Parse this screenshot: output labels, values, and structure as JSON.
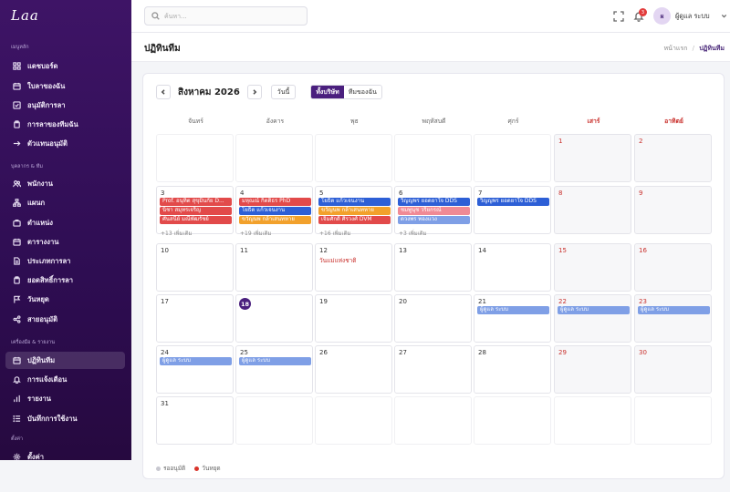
{
  "app": {
    "logo": "Laa"
  },
  "sidebar": {
    "sections": [
      {
        "title": "เมนูหลัก",
        "items": [
          {
            "label": "แดชบอร์ด",
            "icon": "grid-icon"
          },
          {
            "label": "ใบลาของฉัน",
            "icon": "calendar-icon"
          },
          {
            "label": "อนุมัติการลา",
            "icon": "check-square-icon"
          },
          {
            "label": "การลาของทีมฉัน",
            "icon": "clipboard-icon"
          },
          {
            "label": "ตัวแทนอนุมัติ",
            "icon": "arrow-right-icon"
          }
        ]
      },
      {
        "title": "บุคลากร & ทีม",
        "items": [
          {
            "label": "พนักงาน",
            "icon": "users-icon"
          },
          {
            "label": "แผนก",
            "icon": "org-icon"
          },
          {
            "label": "ตำแหน่ง",
            "icon": "briefcase-icon"
          },
          {
            "label": "ตารางงาน",
            "icon": "calendar-icon"
          },
          {
            "label": "ประเภทการลา",
            "icon": "document-icon"
          },
          {
            "label": "ยอดสิทธิ์การลา",
            "icon": "clipboard-icon"
          },
          {
            "label": "วันหยุด",
            "icon": "flag-icon"
          },
          {
            "label": "สายอนุมัติ",
            "icon": "share-icon"
          }
        ]
      },
      {
        "title": "เครื่องมือ & รายงาน",
        "items": [
          {
            "label": "ปฏิทินทีม",
            "icon": "calendar-icon",
            "active": true
          },
          {
            "label": "การแจ้งเตือน",
            "icon": "bell-icon"
          },
          {
            "label": "รายงาน",
            "icon": "bar-chart-icon"
          },
          {
            "label": "บันทึกการใช้งาน",
            "icon": "list-icon"
          }
        ]
      },
      {
        "title": "ตั้งค่า",
        "items": [
          {
            "label": "ตั้งค่า",
            "icon": "gear-icon"
          }
        ]
      }
    ]
  },
  "topbar": {
    "search_placeholder": "ค้นหา...",
    "notification_count": "3",
    "avatar_initial": "ผ",
    "user_name": "ผู้ดูแล ระบบ"
  },
  "page": {
    "title": "ปฏิทินทีม",
    "breadcrumb_home": "หน้าแรก",
    "breadcrumb_sep": "/",
    "breadcrumb_current": "ปฏิทินทีม"
  },
  "calendar": {
    "month_title": "สิงหาคม 2026",
    "today_label": "วันนี้",
    "scope_options": [
      "ทั้งบริษัท",
      "ทีมของฉัน"
    ],
    "scope_selected": "ทั้งบริษัท",
    "weekdays": [
      "จันทร์",
      "อังคาร",
      "พุธ",
      "พฤหัสบดี",
      "ศุกร์",
      "เสาร์",
      "อาทิตย์"
    ],
    "today_day": 18,
    "colors": {
      "red": "#e24a4a",
      "blue": "#2d5fd6",
      "orange": "#f2a12c",
      "pink": "#f08a95",
      "lightblue": "#7f9fe6"
    },
    "weeks": [
      [
        null,
        null,
        null,
        null,
        null,
        {
          "d": 1
        },
        {
          "d": 2
        }
      ],
      [
        {
          "d": 3,
          "events": [
            {
              "t": "Prof. อนุทิต สุขุมิ้นกัย D...",
              "c": "red"
            },
            {
              "t": "นิชา สมุทรเจริญ",
              "c": "red"
            },
            {
              "t": "ศันสนีย์ มณีพัฒรัชย์",
              "c": "red"
            }
          ],
          "more": "+13 เพิ่มเติม"
        },
        {
          "d": 4,
          "events": [
            {
              "t": "มหุณณ์ กิตติธร PhD",
              "c": "red"
            },
            {
              "t": "โยธิต แก้วเจนงาน",
              "c": "blue"
            },
            {
              "t": "ขวัญนพ กล้าเสนทหาย",
              "c": "orange"
            }
          ],
          "more": "+19 เพิ่มเติม"
        },
        {
          "d": 5,
          "events": [
            {
              "t": "โยธิต แก้วเจนงาน",
              "c": "blue"
            },
            {
              "t": "ขวัญนพ กล้าเสนทหาย",
              "c": "orange"
            },
            {
              "t": "เจิมศักดิ์ ศิรวงศ์ DVM",
              "c": "red"
            }
          ],
          "more": "+16 เพิ่มเติม"
        },
        {
          "d": 6,
          "events": [
            {
              "t": "วิญญพร ยอดยาใจ DDS",
              "c": "blue"
            },
            {
              "t": "ชมพูนุช วริยกรณ์",
              "c": "pink"
            },
            {
              "t": "ดวงพร ทองแวง",
              "c": "lightblue"
            }
          ],
          "more": "+3 เพิ่มเติม"
        },
        {
          "d": 7,
          "events": [
            {
              "t": "วิญญพร ยอดยาใจ DDS",
              "c": "blue"
            }
          ]
        },
        {
          "d": 8
        },
        {
          "d": 9
        }
      ],
      [
        {
          "d": 10
        },
        {
          "d": 11
        },
        {
          "d": 12,
          "holiday": "วันแม่แห่งชาติ"
        },
        {
          "d": 13
        },
        {
          "d": 14
        },
        {
          "d": 15
        },
        {
          "d": 16
        }
      ],
      [
        {
          "d": 17
        },
        {
          "d": 18
        },
        {
          "d": 19
        },
        {
          "d": 20
        },
        {
          "d": 21,
          "events": [
            {
              "t": "ผู้ดูแล ระบบ",
              "c": "lightblue"
            }
          ]
        },
        {
          "d": 22,
          "events": [
            {
              "t": "ผู้ดูแล ระบบ",
              "c": "lightblue"
            }
          ]
        },
        {
          "d": 23,
          "events": [
            {
              "t": "ผู้ดูแล ระบบ",
              "c": "lightblue"
            }
          ]
        }
      ],
      [
        {
          "d": 24,
          "events": [
            {
              "t": "ผู้ดูแล ระบบ",
              "c": "lightblue"
            }
          ]
        },
        {
          "d": 25,
          "events": [
            {
              "t": "ผู้ดูแล ระบบ",
              "c": "lightblue"
            }
          ]
        },
        {
          "d": 26
        },
        {
          "d": 27
        },
        {
          "d": 28
        },
        {
          "d": 29
        },
        {
          "d": 30
        }
      ],
      [
        {
          "d": 31
        },
        null,
        null,
        null,
        null,
        null,
        null
      ]
    ],
    "legend": [
      {
        "label": "รออนุมัติ",
        "color": "#c8c8d0"
      },
      {
        "label": "วันหยุด",
        "color": "#d9342b"
      }
    ]
  }
}
